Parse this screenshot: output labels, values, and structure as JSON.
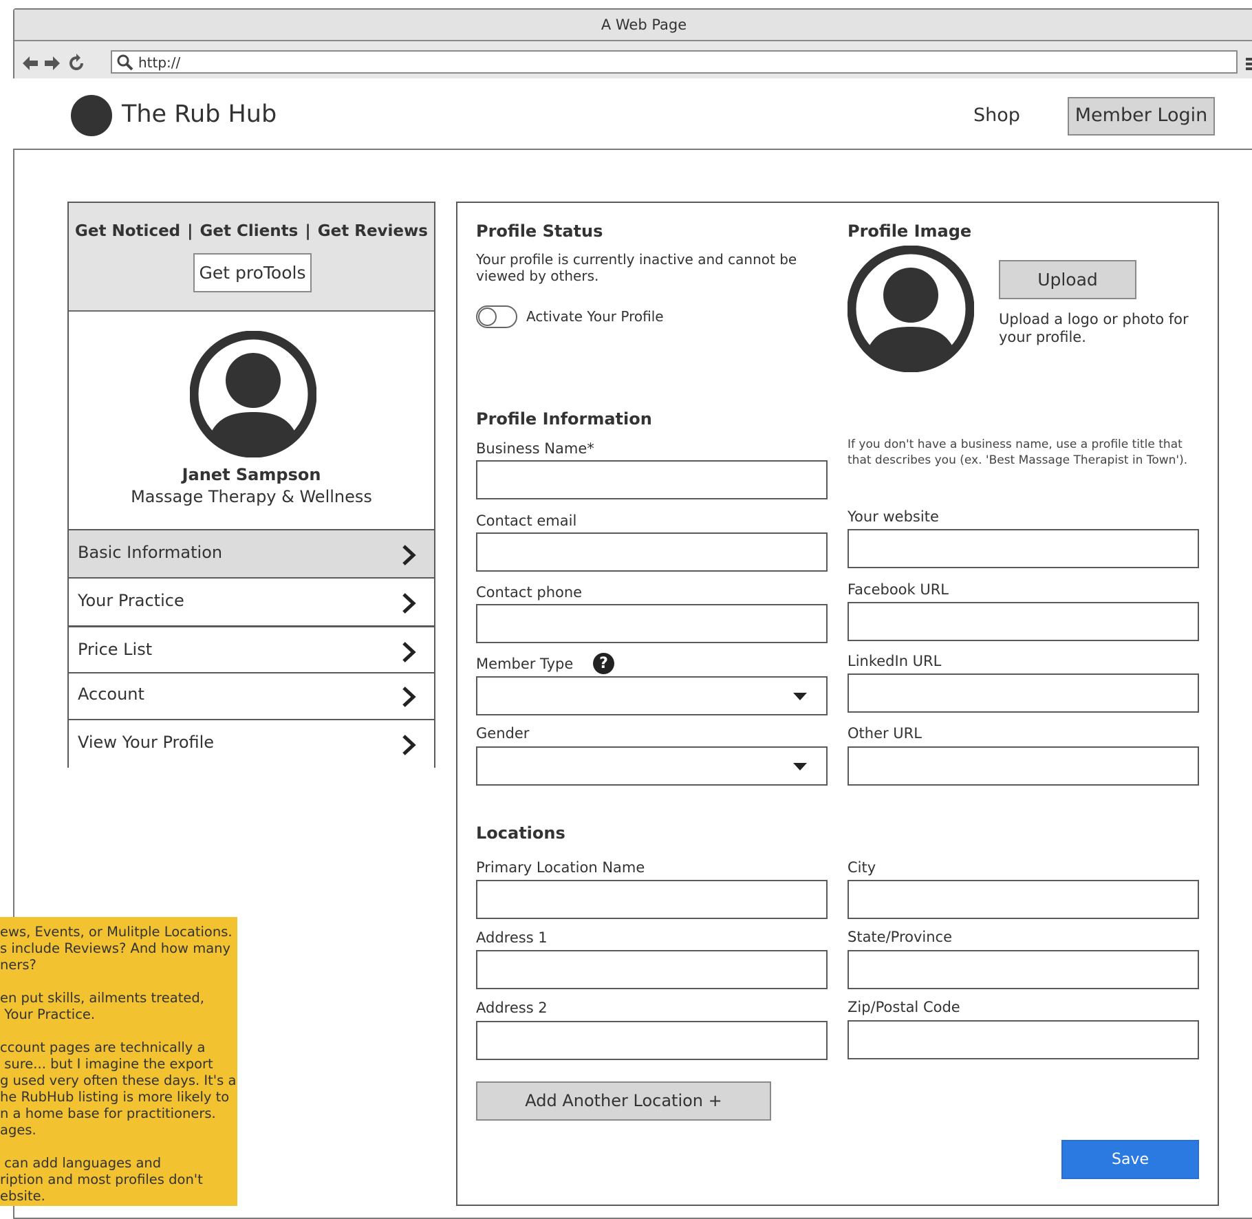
{
  "browser": {
    "title": "A Web Page",
    "url": "http://"
  },
  "header": {
    "brand": "The Rub Hub",
    "shop": "Shop",
    "login": "Member Login"
  },
  "sidebar": {
    "promo": [
      "Get Noticed",
      "Get Clients",
      "Get Reviews"
    ],
    "promo_sep": "|",
    "protools": "Get proTools",
    "name": "Janet Sampson",
    "practice": "Massage Therapy & Wellness",
    "items": [
      {
        "label": "Basic Information"
      },
      {
        "label": "Your Practice"
      },
      {
        "label": "Price List"
      },
      {
        "label": "Account"
      },
      {
        "label": "View Your Profile"
      }
    ]
  },
  "status": {
    "heading": "Profile Status",
    "desc_line1": "Your profile is currently inactive and cannot be",
    "desc_line2": "viewed by others.",
    "toggle_label": "Activate Your Profile"
  },
  "image": {
    "heading": "Profile Image",
    "upload": "Upload",
    "hint_line1": "Upload a logo or photo for",
    "hint_line2": "your profile."
  },
  "info": {
    "heading": "Profile Information",
    "business_name": "Business Name*",
    "business_hint_line1": "If you don't have a business name, use a profile title that",
    "business_hint_line2": "that describes you (ex. 'Best Massage Therapist in Town').",
    "contact_email": "Contact email",
    "website": "Your website",
    "contact_phone": "Contact phone",
    "facebook": "Facebook URL",
    "member_type": "Member Type",
    "help": "?",
    "linkedin": "LinkedIn URL",
    "gender": "Gender",
    "other_url": "Other URL"
  },
  "locations": {
    "heading": "Locations",
    "primary": "Primary Location Name",
    "city": "City",
    "address1": "Address 1",
    "state": "State/Province",
    "address2": "Address 2",
    "zip": "Zip/Postal Code",
    "add": "Add Another Location  +",
    "save": "Save"
  },
  "note": {
    "lines": [
      "ews, Events, or Mulitple Locations.",
      "s include Reviews? And how many",
      "ners?",
      "",
      "en put skills, ailments treated,",
      " Your Practice.",
      "",
      "ccount pages are technically a",
      " sure... but I imagine the export",
      "g used very often these days. It's a",
      "he RubHub listing is more likely to",
      "n a home base for practitioners.",
      "ages.",
      "",
      " can add languages and",
      "ription and most profiles don't",
      "ebsite."
    ]
  },
  "colors": {
    "accent": "#2a7ae2",
    "note": "#f2c230",
    "panel": "#e3e3e3"
  }
}
